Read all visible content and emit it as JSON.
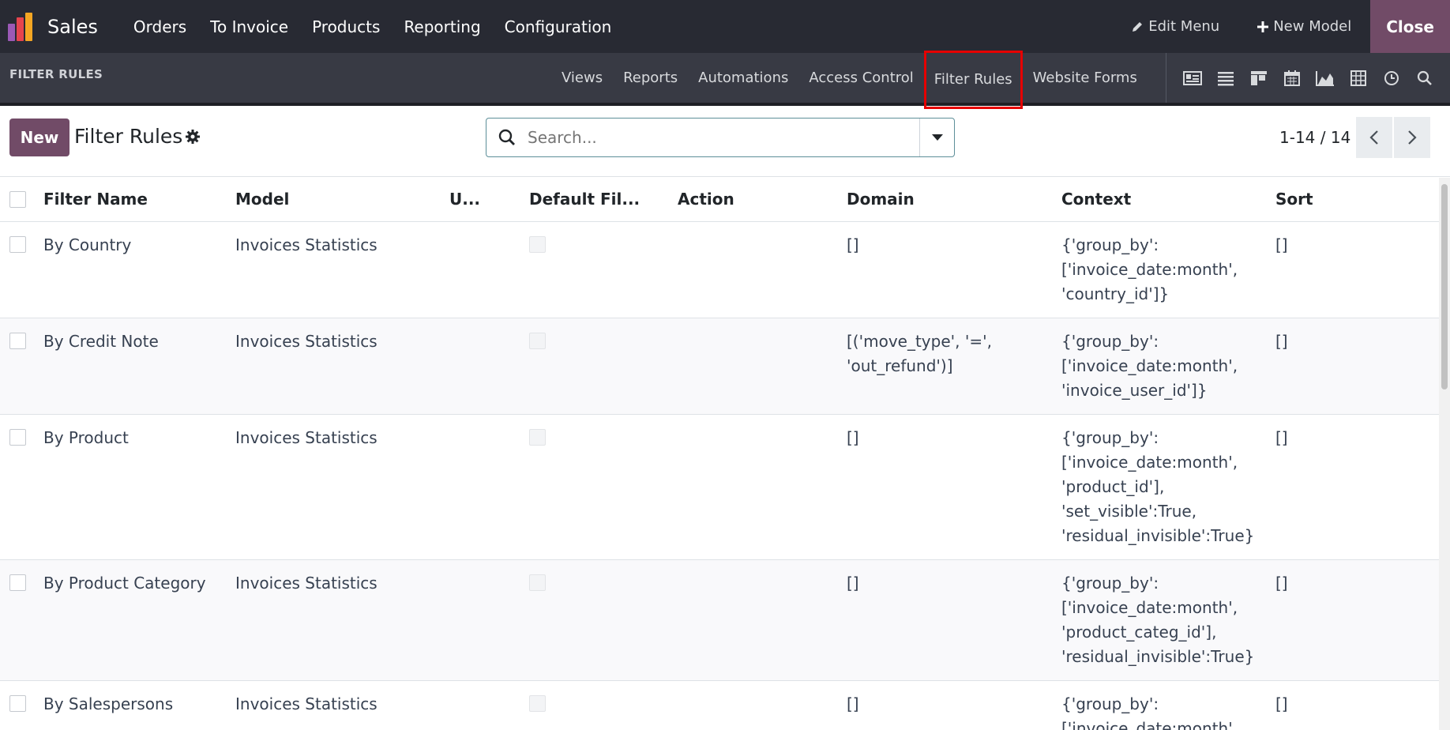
{
  "app": {
    "name": "Sales",
    "logo_colors": [
      "#e6444e",
      "#f5a623",
      "#9b59b6"
    ]
  },
  "top_menu": [
    {
      "label": "Orders"
    },
    {
      "label": "To Invoice"
    },
    {
      "label": "Products"
    },
    {
      "label": "Reporting"
    },
    {
      "label": "Configuration"
    }
  ],
  "top_right": {
    "edit_menu": "Edit Menu",
    "new_model": "New Model",
    "close": "Close"
  },
  "studio": {
    "title": "FILTER RULES",
    "menu": [
      {
        "label": "Views"
      },
      {
        "label": "Reports"
      },
      {
        "label": "Automations"
      },
      {
        "label": "Access Control"
      },
      {
        "label": "Filter Rules"
      },
      {
        "label": "Website Forms"
      }
    ],
    "view_icons": [
      "form-view-icon",
      "list-view-icon",
      "kanban-view-icon",
      "calendar-view-icon",
      "graph-view-icon",
      "pivot-view-icon",
      "activity-view-icon",
      "search-view-icon"
    ]
  },
  "control": {
    "new_label": "New",
    "title": "Filter Rules",
    "search_placeholder": "Search...",
    "pager": "1-14 / 14"
  },
  "table": {
    "columns": [
      "Filter Name",
      "Model",
      "U...",
      "Default Fil...",
      "Action",
      "Domain",
      "Context",
      "Sort"
    ],
    "rows": [
      {
        "name": "By Country",
        "model": "Invoices Statistics",
        "domain": "[]",
        "context": "{'group_by':\n['invoice_date:month',\n'country_id']}",
        "sort": "[]"
      },
      {
        "name": "By Credit Note",
        "model": "Invoices Statistics",
        "domain": "[('move_type', '=',\n'out_refund')]",
        "context": "{'group_by':\n['invoice_date:month',\n'invoice_user_id']}",
        "sort": "[]"
      },
      {
        "name": "By Product",
        "model": "Invoices Statistics",
        "domain": "[]",
        "context": "{'group_by':\n['invoice_date:month',\n'product_id'],\n'set_visible':True,\n'residual_invisible':True}",
        "sort": "[]"
      },
      {
        "name": "By Product Category",
        "model": "Invoices Statistics",
        "domain": "[]",
        "context": "{'group_by':\n['invoice_date:month',\n'product_categ_id'],\n'residual_invisible':True}",
        "sort": "[]"
      },
      {
        "name": "By Salespersons",
        "model": "Invoices Statistics",
        "domain": "[]",
        "context": "{'group_by':\n['invoice_date:month',",
        "sort": "[]"
      }
    ]
  },
  "colors": {
    "brand": "#714b67",
    "topbar": "#282a33",
    "subbar": "#383a44",
    "highlight": "#e60000"
  }
}
